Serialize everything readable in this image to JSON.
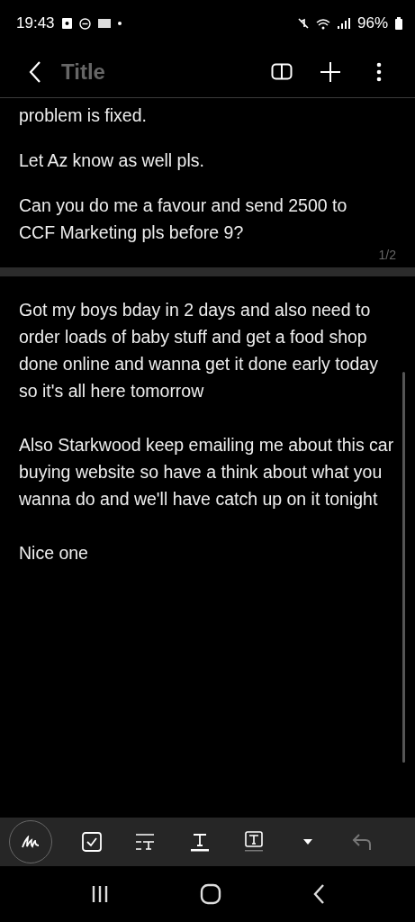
{
  "status_bar": {
    "time": "19:43",
    "battery": "96%"
  },
  "header": {
    "title_placeholder": "Title"
  },
  "pages": [
    {
      "paragraphs": [
        "problem is fixed.",
        "Let Az know as well pls.",
        "Can you do me a favour and send 2500 to CCF Marketing pls before 9?"
      ],
      "page_number": "1/2"
    },
    {
      "paragraphs": [
        "Got my boys bday in 2 days and also need to order loads of baby stuff and get a food shop done online and wanna get it done early today so it's all here tomorrow",
        "Also Starkwood keep emailing me about this car buying website so have a think about what you wanna do and we'll have catch up on it tonight",
        "Nice one"
      ]
    }
  ],
  "toolbar": {
    "undo": {
      "disabled": true
    }
  }
}
